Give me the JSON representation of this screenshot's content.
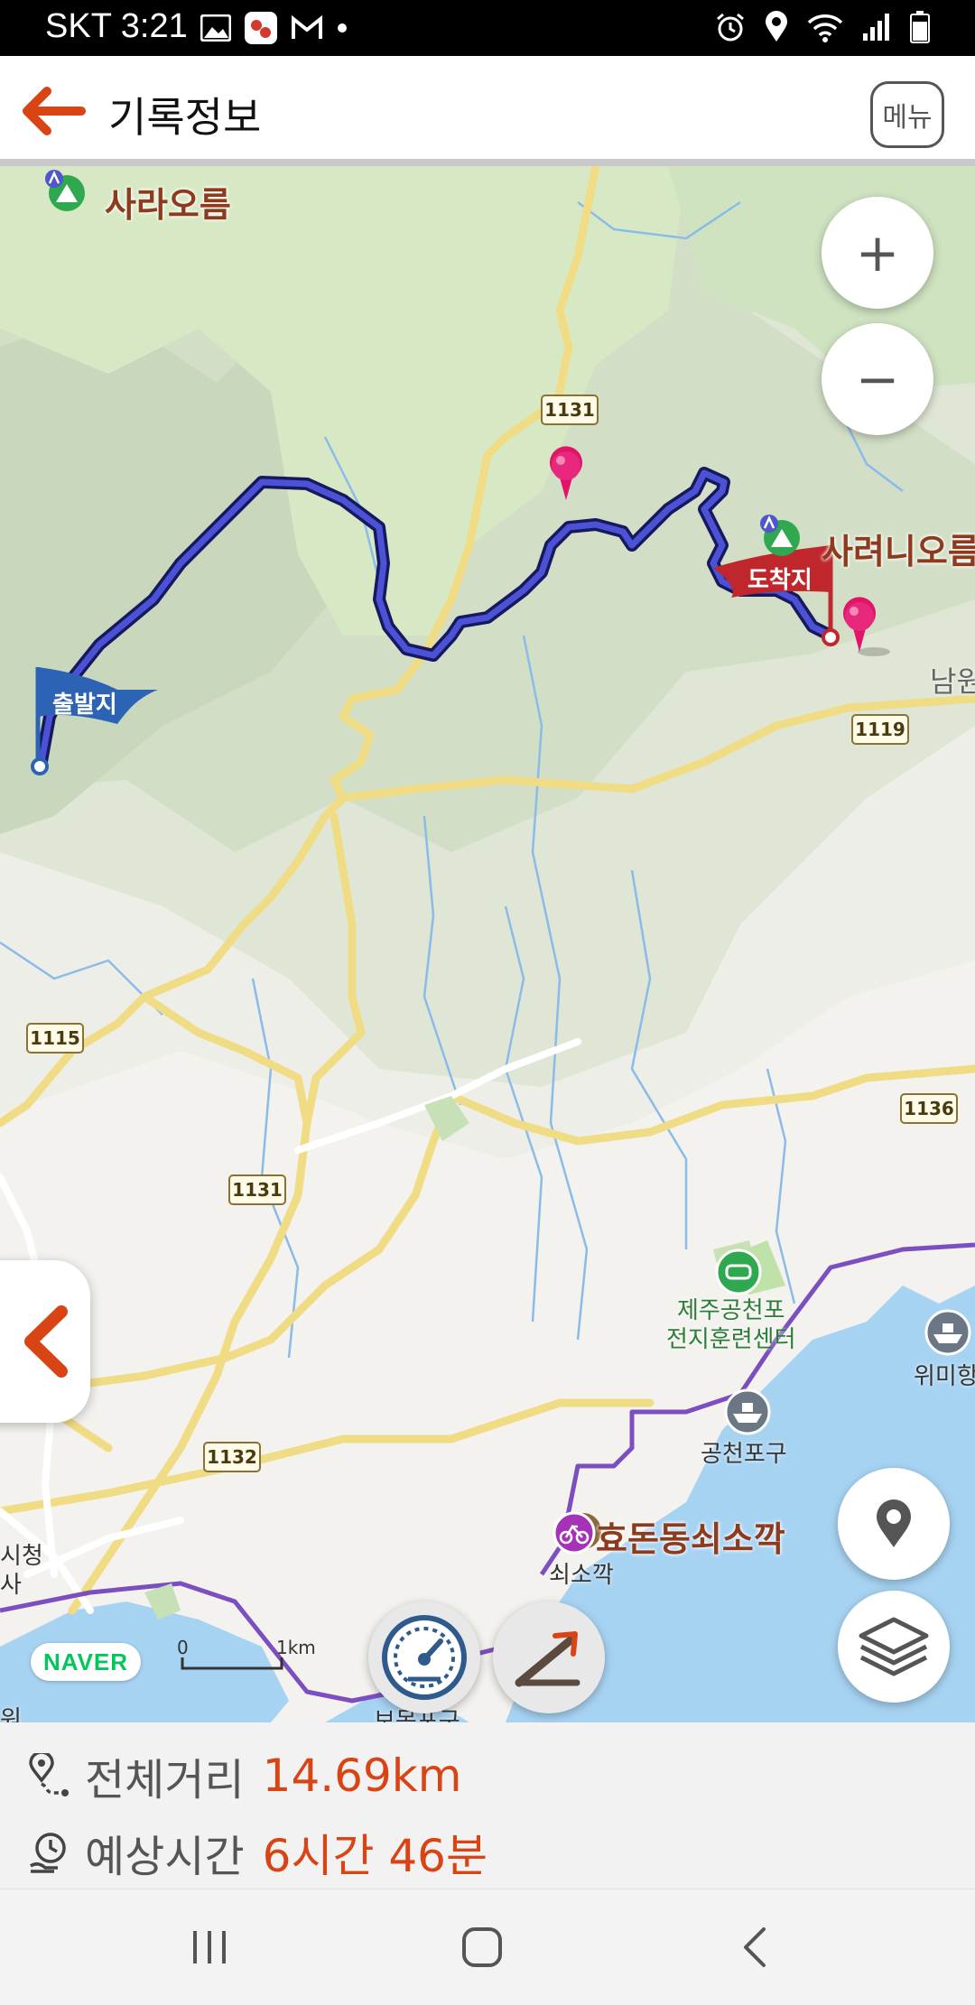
{
  "status_bar": {
    "carrier_time": "SKT 3:21",
    "icons": [
      "gallery-icon",
      "app-notification-icon",
      "gmail-icon",
      "dot-icon",
      "alarm-icon",
      "location-icon",
      "wifi-icon",
      "signal-icon",
      "battery-icon"
    ]
  },
  "header": {
    "title": "기록정보",
    "menu_label": "메뉴"
  },
  "map": {
    "places": {
      "sara_oreum": "사라오름",
      "saryeoni_oreum": "사려니오름",
      "namwon": "남원",
      "jeju_training_center": "제주공천포\n전지훈련센터",
      "wimi_port": "위미항",
      "gongcheon_port": "공천포구",
      "hyodon_cape": "효돈동쇠소깍",
      "sosokkak": "쇠소깍",
      "city_hall_annex": "시청\n사",
      "bottom_cut_label": "보목포구",
      "left_cut_label": "워"
    },
    "roads": [
      "1131",
      "1119",
      "1115",
      "1136",
      "1131",
      "1132"
    ],
    "flags": {
      "start": "출발지",
      "end": "도착지"
    },
    "scale": {
      "zero": "0",
      "unit": "1km"
    },
    "brand": "NAVER",
    "controls": {
      "zoom_in": "+",
      "zoom_out": "−"
    }
  },
  "stats": {
    "distance_label": "전체거리",
    "distance_value": "14.69km",
    "time_label": "예상시간",
    "time_value": "6시간 46분"
  },
  "colors": {
    "accent": "#d94414",
    "route": "#3a3fc4",
    "start_flag": "#2d63b5",
    "end_flag": "#c0272d",
    "sea": "#a7d3f2",
    "forest": "#cfe3c1"
  }
}
